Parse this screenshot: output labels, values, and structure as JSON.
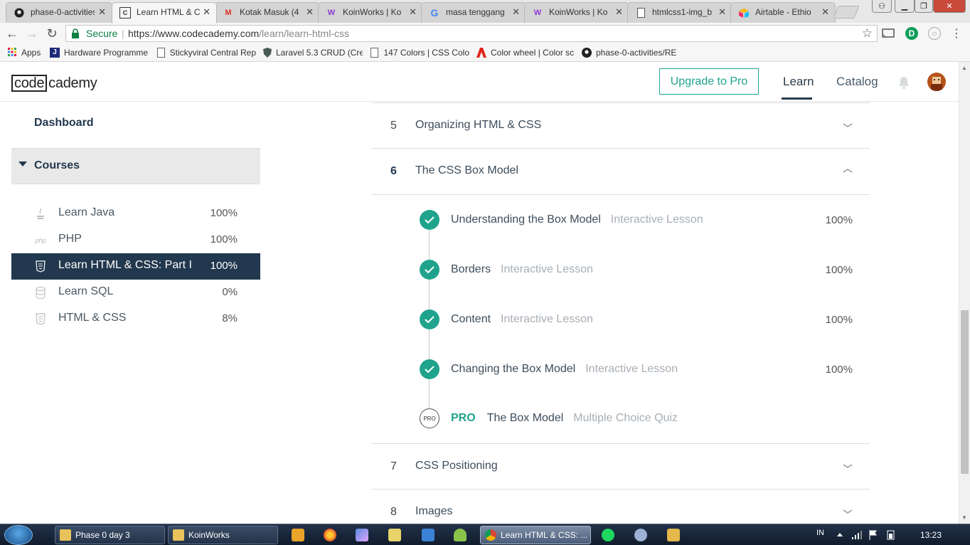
{
  "browser": {
    "tabs": [
      {
        "title": "phase-0-activities",
        "favicon": "github-icon"
      },
      {
        "title": "Learn HTML & CSS",
        "favicon": "codecademy-icon",
        "active": true
      },
      {
        "title": "Kotak Masuk (4",
        "favicon": "gmail-icon"
      },
      {
        "title": "KoinWorks | Ko",
        "favicon": "koinworks-icon"
      },
      {
        "title": "masa tenggang",
        "favicon": "google-icon"
      },
      {
        "title": "KoinWorks | Ko",
        "favicon": "koinworks-icon"
      },
      {
        "title": "htmlcss1-img_b",
        "favicon": "page-icon"
      },
      {
        "title": "Airtable - Ethio",
        "favicon": "airtable-icon"
      }
    ],
    "address": {
      "secure_label": "Secure",
      "url_host": "https://www.codecademy.com",
      "url_path": "/learn/learn-html-css"
    },
    "bookmarks": [
      {
        "label": "Apps",
        "icon": "apps-grid-icon"
      },
      {
        "label": "Hardware Programme",
        "icon": "bookmark-j-icon"
      },
      {
        "label": "Stickyviral Central Rep",
        "icon": "page-icon"
      },
      {
        "label": "Laravel 5.3 CRUD (Cre",
        "icon": "shield-icon"
      },
      {
        "label": "147 Colors | CSS Colo",
        "icon": "page-icon"
      },
      {
        "label": "Color wheel | Color sc",
        "icon": "adobe-icon"
      },
      {
        "label": "phase-0-activities/RE",
        "icon": "github-icon"
      }
    ]
  },
  "header": {
    "logo_box": "code",
    "logo_rest": "cademy",
    "upgrade_label": "Upgrade to Pro",
    "nav": {
      "learn": "Learn",
      "catalog": "Catalog"
    }
  },
  "sidebar": {
    "dashboard": "Dashboard",
    "courses_label": "Courses",
    "courses": [
      {
        "name": "Learn Java",
        "progress": "100%",
        "icon": "java-icon"
      },
      {
        "name": "PHP",
        "progress": "100%",
        "icon": "php-icon"
      },
      {
        "name": "Learn HTML & CSS: Part I",
        "progress": "100%",
        "icon": "html5-icon",
        "selected": true
      },
      {
        "name": "Learn SQL",
        "progress": "0%",
        "icon": "database-icon"
      },
      {
        "name": "HTML & CSS",
        "progress": "8%",
        "icon": "html5-icon"
      }
    ]
  },
  "syllabus": {
    "units": [
      {
        "number": "5",
        "title": "Organizing HTML & CSS",
        "expanded": false
      },
      {
        "number": "6",
        "title": "The CSS Box Model",
        "expanded": true
      },
      {
        "number": "7",
        "title": "CSS Positioning",
        "expanded": false
      },
      {
        "number": "8",
        "title": "Images",
        "expanded": false
      }
    ],
    "lessons": [
      {
        "name": "Understanding the Box Model",
        "type": "Interactive Lesson",
        "progress": "100%"
      },
      {
        "name": "Borders",
        "type": "Interactive Lesson",
        "progress": "100%"
      },
      {
        "name": "Content",
        "type": "Interactive Lesson",
        "progress": "100%"
      },
      {
        "name": "Changing the Box Model",
        "type": "Interactive Lesson",
        "progress": "100%"
      }
    ],
    "pro_lesson": {
      "badge": "PRO",
      "circle": "PRO",
      "name": "The Box Model",
      "type": "Multiple Choice Quiz"
    }
  },
  "taskbar": {
    "tasks": [
      {
        "label": "Phase 0 day 3",
        "icon": "folder-icon"
      },
      {
        "label": "KoinWorks",
        "icon": "folder-icon"
      },
      {
        "label": "Learn HTML & CSS: ...",
        "icon": "chrome-icon",
        "active": true
      }
    ],
    "language": "IN",
    "clock": "13:23"
  },
  "colors": {
    "accent": "#20a38d",
    "navy": "#22384e"
  }
}
